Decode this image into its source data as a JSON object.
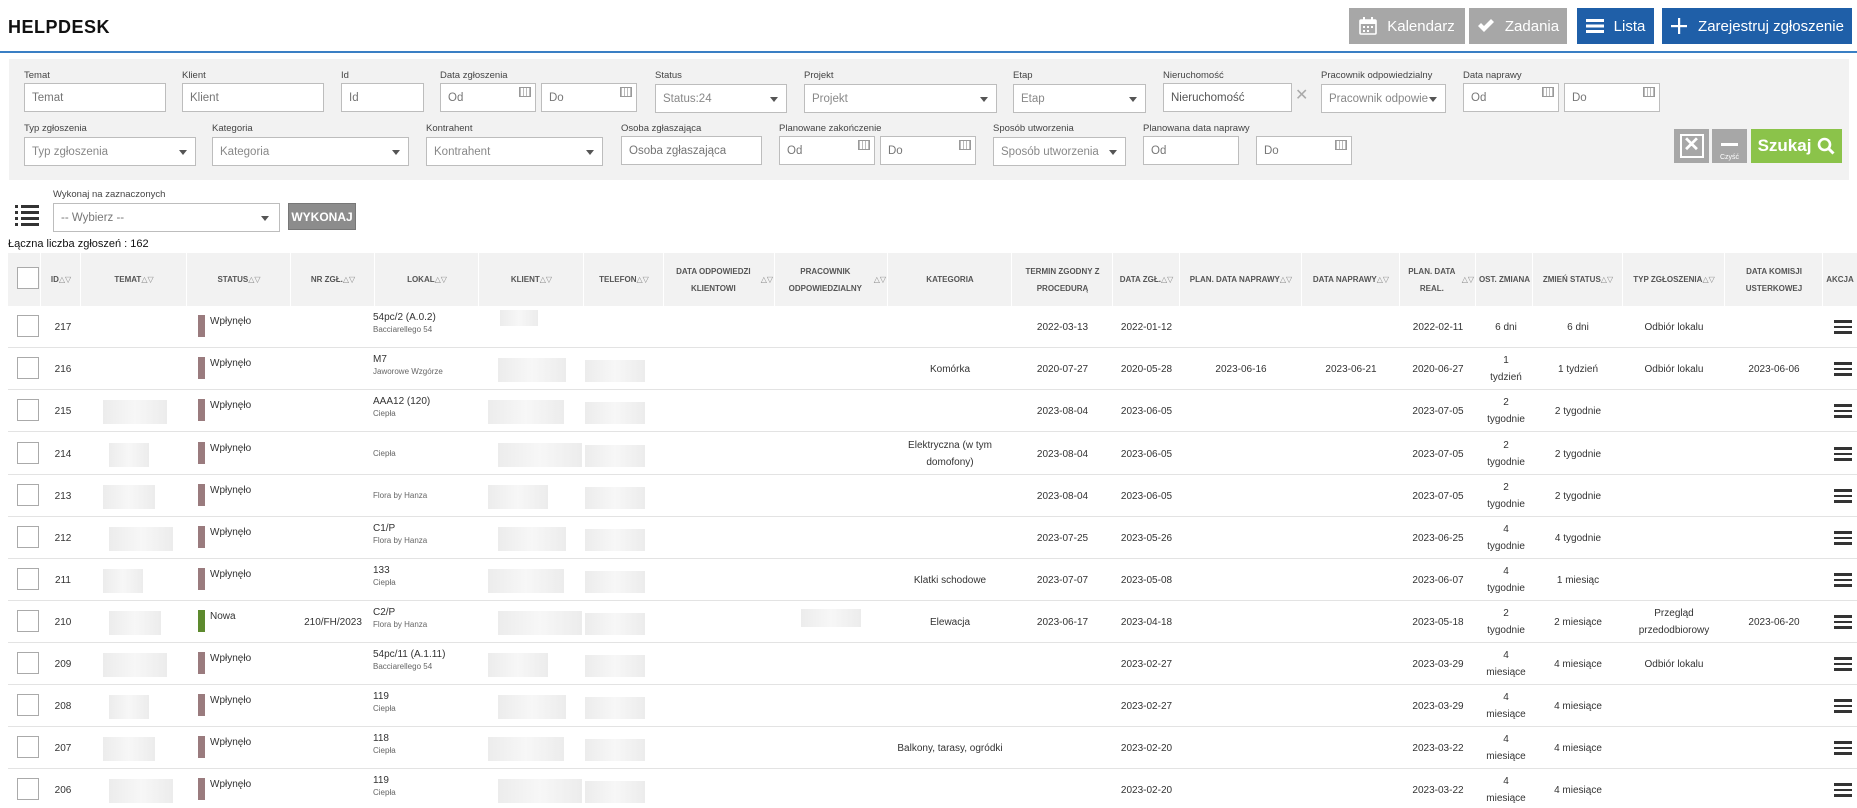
{
  "header": {
    "title": "HELPDESK",
    "buttons": {
      "kalendarz": "Kalendarz",
      "zadania": "Zadania",
      "lista": "Lista",
      "zarejestruj": "Zarejestruj zgłoszenie"
    }
  },
  "filters": {
    "row1": [
      {
        "key": "temat",
        "label": "Temat",
        "placeholder": "Temat"
      },
      {
        "key": "klient",
        "label": "Klient",
        "placeholder": "Klient"
      },
      {
        "key": "id",
        "label": "Id",
        "placeholder": "Id"
      },
      {
        "key": "data_zgl",
        "label": "Data zgłoszenia",
        "from": "Od",
        "to": "Do"
      },
      {
        "key": "status",
        "label": "Status",
        "value": "Status:24"
      },
      {
        "key": "projekt",
        "label": "Projekt",
        "value": "Projekt"
      },
      {
        "key": "etap",
        "label": "Etap",
        "value": "Etap"
      },
      {
        "key": "nieruchomosc",
        "label": "Nieruchomość",
        "value": "Nieruchomość"
      },
      {
        "key": "pracownik",
        "label": "Pracownik odpowiedzialny",
        "value": "Pracownik odpowie"
      },
      {
        "key": "data_naprawy",
        "label": "Data naprawy",
        "from": "Od",
        "to": "Do"
      }
    ],
    "row2": [
      {
        "key": "typ",
        "label": "Typ zgłoszenia",
        "value": "Typ zgłoszenia"
      },
      {
        "key": "kategoria",
        "label": "Kategoria",
        "value": "Kategoria"
      },
      {
        "key": "kontrahent",
        "label": "Kontrahent",
        "value": "Kontrahent"
      },
      {
        "key": "osoba",
        "label": "Osoba zgłaszająca",
        "placeholder": "Osoba zgłaszająca"
      },
      {
        "key": "plan_zak",
        "label": "Planowane zakończenie",
        "from": "Od",
        "to": "Do"
      },
      {
        "key": "sposob",
        "label": "Sposób utworzenia",
        "value": "Sposób utworzenia"
      },
      {
        "key": "plan_naprawy",
        "label": "Planowana data naprawy",
        "from": "Od",
        "to": "Do"
      }
    ],
    "clear_caption": "Czyść",
    "search_label": "Szukaj"
  },
  "bulk": {
    "label": "Wykonaj na zaznaczonych",
    "select": "-- Wybierz --",
    "button": "WYKONAJ"
  },
  "total_text": "Łączna liczba zgłoszeń : 162",
  "columns": [
    "ID",
    "TEMAT",
    "STATUS",
    "NR ZGŁ.",
    "LOKAL",
    "KLIENT",
    "TELEFON",
    "DATA ODPOWIEDZI KLIENTOWI",
    "PRACOWNIK ODPOWIEDZIALNY",
    "KATEGORIA",
    "TERMIN ZGODNY Z PROCEDURĄ",
    "DATA ZGŁ.",
    "PLAN. DATA NAPRAWY",
    "DATA NAPRAWY",
    "PLAN. DATA REAL.",
    "OST. ZMIANA",
    "ZMIEŃ STATUS",
    "TYP ZGŁOSZENIA",
    "DATA KOMISJI USTERKOWEJ",
    "AKCJA"
  ],
  "colors": {
    "accent": "#1f5fa8",
    "gray_btn": "#a7a7a7",
    "search_green": "#8bc34a",
    "status_wplynelo": "#9a7b7e",
    "status_nowa": "#5d8a2e"
  },
  "rows": [
    {
      "id": "217",
      "status": "Wpłynęło",
      "nr": "",
      "lokal1": "54pc/2 (A.0.2)",
      "lokal2": "Bacciarellego 54",
      "kategoria": "",
      "termin": "2022-03-13",
      "data_zgl": "2022-01-12",
      "plan_napr": "",
      "data_napr": "",
      "plan_real": "2022-02-11",
      "ost": "6 dni",
      "zmien": "6 dni",
      "typ": "Odbiór lokalu",
      "komisja": ""
    },
    {
      "id": "216",
      "status": "Wpłynęło",
      "nr": "",
      "lokal1": "M7",
      "lokal2": "Jaworowe Wzgórze",
      "kategoria": "Komórka",
      "termin": "2020-07-27",
      "data_zgl": "2020-05-28",
      "plan_napr": "2023-06-16",
      "data_napr": "2023-06-21",
      "plan_real": "2020-06-27",
      "ost": "1 tydzień",
      "zmien": "1 tydzień",
      "typ": "Odbiór lokalu",
      "komisja": "2023-06-06"
    },
    {
      "id": "215",
      "status": "Wpłynęło",
      "nr": "",
      "lokal1": "AAA12 (120)",
      "lokal2": "Ciepła",
      "kategoria": "",
      "termin": "2023-08-04",
      "data_zgl": "2023-06-05",
      "plan_napr": "",
      "data_napr": "",
      "plan_real": "2023-07-05",
      "ost": "2 tygodnie",
      "zmien": "2 tygodnie",
      "typ": "",
      "komisja": ""
    },
    {
      "id": "214",
      "status": "Wpłynęło",
      "nr": "",
      "lokal1": "",
      "lokal2": "Ciepła",
      "kategoria": "Elektryczna (w tym domofony)",
      "termin": "2023-08-04",
      "data_zgl": "2023-06-05",
      "plan_napr": "",
      "data_napr": "",
      "plan_real": "2023-07-05",
      "ost": "2 tygodnie",
      "zmien": "2 tygodnie",
      "typ": "",
      "komisja": ""
    },
    {
      "id": "213",
      "status": "Wpłynęło",
      "nr": "",
      "lokal1": "",
      "lokal2": "Flora by Hanza",
      "kategoria": "",
      "termin": "2023-08-04",
      "data_zgl": "2023-06-05",
      "plan_napr": "",
      "data_napr": "",
      "plan_real": "2023-07-05",
      "ost": "2 tygodnie",
      "zmien": "2 tygodnie",
      "typ": "",
      "komisja": ""
    },
    {
      "id": "212",
      "status": "Wpłynęło",
      "nr": "",
      "lokal1": "C1/P",
      "lokal2": "Flora by Hanza",
      "kategoria": "",
      "termin": "2023-07-25",
      "data_zgl": "2023-05-26",
      "plan_napr": "",
      "data_napr": "",
      "plan_real": "2023-06-25",
      "ost": "4 tygodnie",
      "zmien": "4 tygodnie",
      "typ": "",
      "komisja": ""
    },
    {
      "id": "211",
      "status": "Wpłynęło",
      "nr": "",
      "lokal1": "133",
      "lokal2": "Ciepła",
      "kategoria": "Klatki schodowe",
      "termin": "2023-07-07",
      "data_zgl": "2023-05-08",
      "plan_napr": "",
      "data_napr": "",
      "plan_real": "2023-06-07",
      "ost": "4 tygodnie",
      "zmien": "1 miesiąc",
      "typ": "",
      "komisja": ""
    },
    {
      "id": "210",
      "status": "Nowa",
      "nr": "210/FH/2023",
      "lokal1": "C2/P",
      "lokal2": "Flora by Hanza",
      "kategoria": "Elewacja",
      "termin": "2023-06-17",
      "data_zgl": "2023-04-18",
      "plan_napr": "",
      "data_napr": "",
      "plan_real": "2023-05-18",
      "ost": "2 tygodnie",
      "zmien": "2 miesiące",
      "typ": "Przegląd przedodbiorowy",
      "komisja": "2023-06-20"
    },
    {
      "id": "209",
      "status": "Wpłynęło",
      "nr": "",
      "lokal1": "54pc/11 (A.1.11)",
      "lokal2": "Bacciarellego 54",
      "kategoria": "",
      "termin": "",
      "data_zgl": "2023-02-27",
      "plan_napr": "",
      "data_napr": "",
      "plan_real": "2023-03-29",
      "ost": "4 miesiące",
      "zmien": "4 miesiące",
      "typ": "Odbiór lokalu",
      "komisja": ""
    },
    {
      "id": "208",
      "status": "Wpłynęło",
      "nr": "",
      "lokal1": "119",
      "lokal2": "Ciepła",
      "kategoria": "",
      "termin": "",
      "data_zgl": "2023-02-27",
      "plan_napr": "",
      "data_napr": "",
      "plan_real": "2023-03-29",
      "ost": "4 miesiące",
      "zmien": "4 miesiące",
      "typ": "",
      "komisja": ""
    },
    {
      "id": "207",
      "status": "Wpłynęło",
      "nr": "",
      "lokal1": "118",
      "lokal2": "Ciepła",
      "kategoria": "Balkony, tarasy, ogródki",
      "termin": "",
      "data_zgl": "2023-02-20",
      "plan_napr": "",
      "data_napr": "",
      "plan_real": "2023-03-22",
      "ost": "4 miesiące",
      "zmien": "4 miesiące",
      "typ": "",
      "komisja": ""
    },
    {
      "id": "206",
      "status": "Wpłynęło",
      "nr": "",
      "lokal1": "119",
      "lokal2": "Ciepła",
      "kategoria": "",
      "termin": "",
      "data_zgl": "2023-02-20",
      "plan_napr": "",
      "data_napr": "",
      "plan_real": "2023-03-22",
      "ost": "4 miesiące",
      "zmien": "4 miesiące",
      "typ": "",
      "komisja": ""
    }
  ]
}
